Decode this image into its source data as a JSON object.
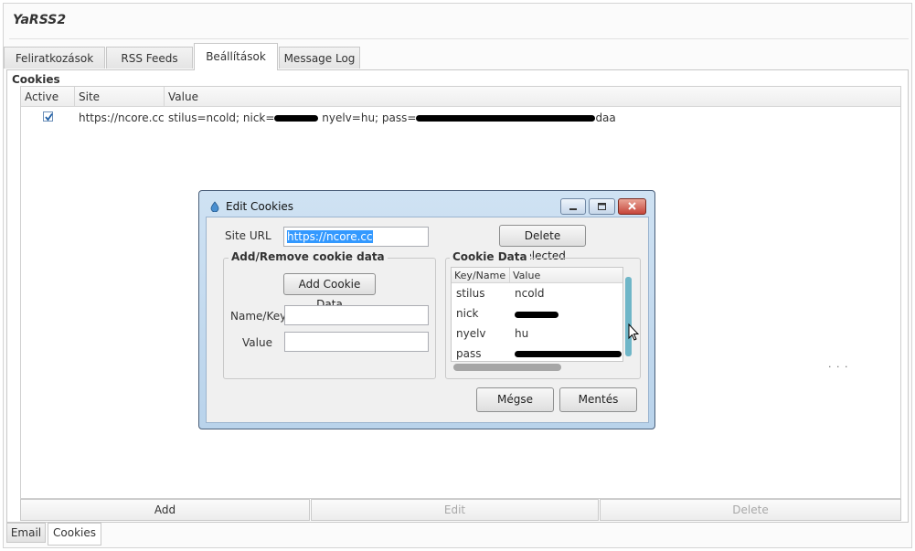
{
  "app": {
    "title": "YaRSS2"
  },
  "tabs": [
    {
      "label": "Feliratkozások"
    },
    {
      "label": "RSS Feeds"
    },
    {
      "label": "Beállítások"
    },
    {
      "label": "Message Log"
    }
  ],
  "cookies_section": {
    "group_label": "Cookies",
    "columns": [
      "Active",
      "Site",
      "Value"
    ],
    "rows": [
      {
        "active": true,
        "site": "https://ncore.cc",
        "value_prefix": "stilus=ncold; nick=",
        "value_mid": " nyelv=hu; pass=",
        "value_suffix": "daa"
      }
    ]
  },
  "bottom_buttons": {
    "add": "Add",
    "edit": "Edit",
    "delete": "Delete"
  },
  "bottom_tabs": [
    {
      "label": "Email"
    },
    {
      "label": "Cookies"
    }
  ],
  "dialog": {
    "title": "Edit Cookies",
    "site_url_label": "Site URL",
    "site_url_value": "https://ncore.cc",
    "delete_selected": "Delete selected",
    "add_remove_legend": "Add/Remove cookie data",
    "add_cookie_button": "Add Cookie Data",
    "name_key_label": "Name/Key",
    "value_label": "Value",
    "cookie_data_legend": "Cookie Data",
    "list_columns": [
      "Key/Name",
      "Value"
    ],
    "list_rows": [
      {
        "key": "stilus",
        "value": "ncold"
      },
      {
        "key": "nick",
        "value": ""
      },
      {
        "key": "nyelv",
        "value": "hu"
      },
      {
        "key": "pass",
        "value": ""
      }
    ],
    "cancel_button": "Mégse",
    "save_button": "Mentés"
  },
  "stray_text": ". . ."
}
